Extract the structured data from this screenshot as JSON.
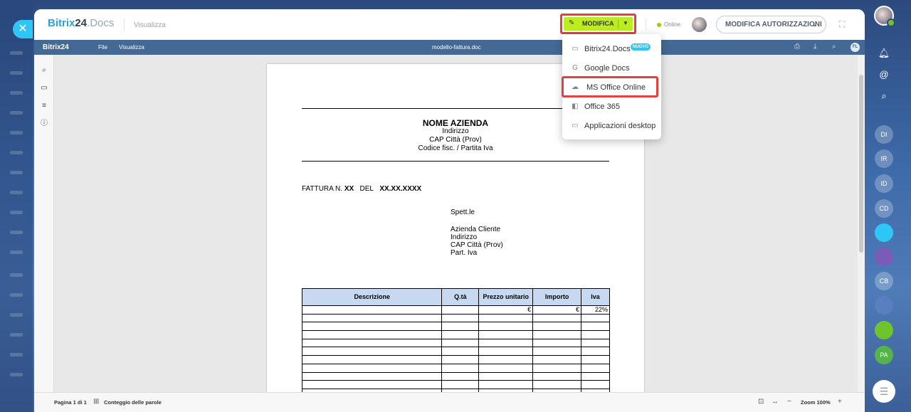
{
  "app": {
    "logo_brand": "Bitrix",
    "logo_num": "24",
    "logo_suffix": ".Docs",
    "mode_label": "Visualizza"
  },
  "toolbar": {
    "edit_label": "MODIFICA",
    "online_label": "Online",
    "permissions_label": "MODIFICA AUTORIZZAZIONI"
  },
  "editor_bar": {
    "logo": "Bitrix24",
    "menu": [
      "File",
      "Visualizza"
    ],
    "filename": "modello-fattura.doc",
    "user_initials": "FL"
  },
  "edit_menu": {
    "items": [
      {
        "label": "Bitrix24.Docs",
        "badge": "NUOVO",
        "icon": "drive-icon"
      },
      {
        "label": "Google Docs",
        "icon": "google-icon"
      },
      {
        "label": "MS Office Online",
        "icon": "cloud-icon"
      },
      {
        "label": "Office 365",
        "icon": "office-icon"
      },
      {
        "label": "Applicazioni desktop",
        "icon": "monitor-icon"
      }
    ]
  },
  "document": {
    "company": "NOME AZIENDA",
    "company_lines": [
      "Indirizzo",
      "CAP Città (Prov)",
      "Codice fisc. / Partita Iva"
    ],
    "invoice_prefix": "FATTURA N.",
    "invoice_number": "XX",
    "invoice_del": "DEL",
    "invoice_date": "XX.XX.XXXX",
    "client_greeting": "Spett.le",
    "client_lines": [
      "Azienda Cliente",
      "Indirizzo",
      "CAP Città (Prov)",
      "Part. Iva"
    ],
    "table": {
      "headers": [
        "Descrizione",
        "Q.tà",
        "Prezzo unitario",
        "Importo",
        "Iva"
      ],
      "first_row": [
        "",
        "",
        "€",
        "€",
        "22%"
      ]
    }
  },
  "statusbar": {
    "page_info": "Pagina 1 di 1",
    "word_count": "Conteggio delle parole",
    "zoom": "Zoom 100%"
  },
  "rail": {
    "items": [
      "DI",
      "IR",
      "ID",
      "CD",
      "CB",
      "PA"
    ]
  },
  "colors": {
    "accent": "#2fc6f6",
    "edit_button": "#bbed21",
    "editor_bar": "#446995",
    "highlight": "#e3413d",
    "table_header": "#c6d9f0"
  }
}
